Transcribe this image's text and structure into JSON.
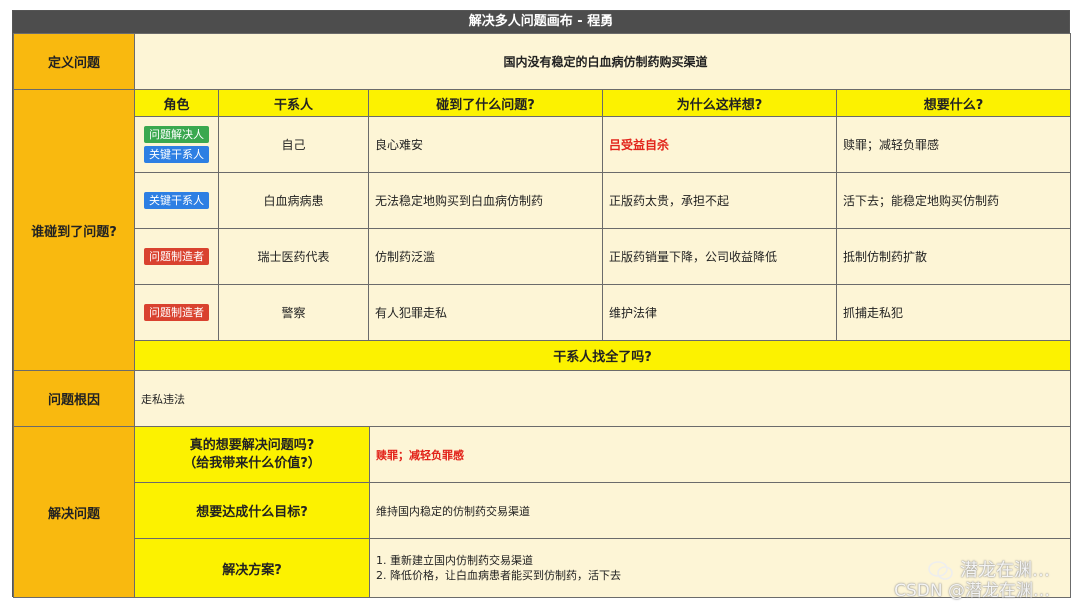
{
  "title": "解决多人问题画布 - 程勇",
  "define": {
    "label": "定义问题",
    "value": "国内没有稳定的白血病仿制药购买渠道"
  },
  "who": {
    "label": "谁碰到了问题?",
    "headers": [
      "角色",
      "干系人",
      "碰到了什么问题?",
      "为什么这样想?",
      "想要什么?"
    ],
    "rows": [
      {
        "badges": [
          {
            "text": "问题解决人",
            "color": "#3aa84f"
          },
          {
            "text": "关键干系人",
            "color": "#2d7fe3"
          }
        ],
        "stakeholder": "自己",
        "problem": "良心难安",
        "reason": "吕受益自杀",
        "want": "赎罪；减轻负罪感"
      },
      {
        "badges": [
          {
            "text": "关键干系人",
            "color": "#2d7fe3"
          }
        ],
        "stakeholder": "白血病病患",
        "problem": "无法稳定地购买到白血病仿制药",
        "reason": "正版药太贵，承担不起",
        "want": "活下去；能稳定地购买仿制药"
      },
      {
        "badges": [
          {
            "text": "问题制造者",
            "color": "#d9422f"
          }
        ],
        "stakeholder": "瑞士医药代表",
        "problem": "仿制药泛滥",
        "reason": "正版药销量下降，公司收益降低",
        "want": "抵制仿制药扩散"
      },
      {
        "badges": [
          {
            "text": "问题制造者",
            "color": "#d9422f"
          }
        ],
        "stakeholder": "警察",
        "problem": "有人犯罪走私",
        "reason": "维护法律",
        "want": "抓捕走私犯"
      }
    ],
    "footer": "干系人找全了吗?"
  },
  "root": {
    "label": "问题根因",
    "value": "走私违法"
  },
  "solve": {
    "label": "解决问题",
    "q1_line1": "真的想要解决问题吗?",
    "q1_line2": "（给我带来什么价值?）",
    "a1": "赎罪；减轻负罪感",
    "q2": "想要达成什么目标?",
    "a2": "维持国内稳定的仿制药交易渠道",
    "q3": "解决方案?",
    "a3_1": "1. 重新建立国内仿制药交易渠道",
    "a3_2": "2. 降低价格，让白血病患者能买到仿制药，活下去"
  },
  "watermark": {
    "line1": "潜龙在渊…",
    "line2": "CSDN @潜龙在渊…"
  }
}
